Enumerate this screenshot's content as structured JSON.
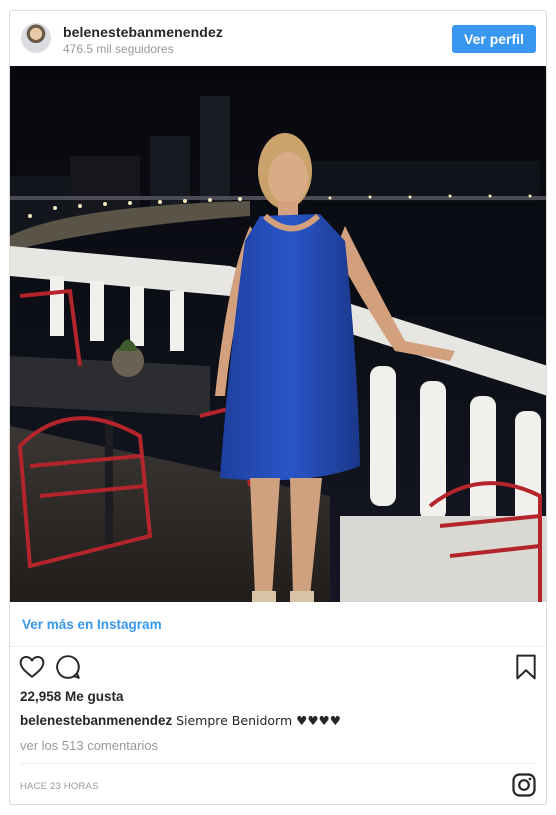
{
  "post": {
    "username": "belenestebanmenendez",
    "followers": "476.5 mil seguidores",
    "follow_label": "Ver perfil",
    "view_more_label": "Ver más en Instagram",
    "likes": "22,958 Me gusta",
    "caption_user": "belenestebanmenendez",
    "caption_text": "Siempre Benidorm ♥♥♥♥",
    "comments_link": "ver los 513 comentarios",
    "timestamp": "HACE 23 HORAS"
  },
  "icons": {
    "like": "heart-icon",
    "comment": "comment-icon",
    "save": "bookmark-icon",
    "brand": "instagram-icon"
  },
  "colors": {
    "accent": "#3897f0",
    "text": "#262626",
    "muted": "#999999",
    "border": "#dbdbdb"
  }
}
